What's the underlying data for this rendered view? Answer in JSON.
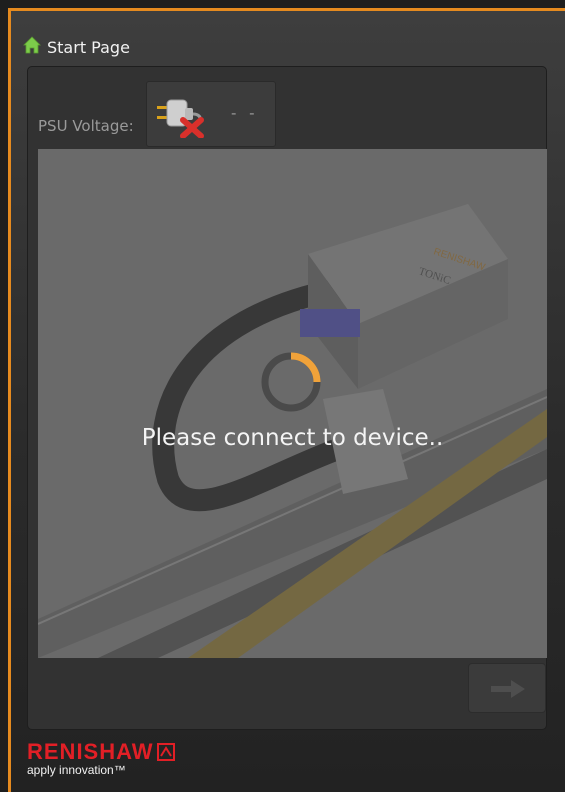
{
  "header": {
    "title": "Start Page",
    "home_icon": "home-icon"
  },
  "psu": {
    "label": "PSU Voltage:",
    "value": "- -",
    "status_icon": "unplugged-power-icon"
  },
  "main": {
    "message": "Please connect to device..",
    "spinner_icon": "loading-spinner-icon"
  },
  "navigation": {
    "next_icon": "arrow-right-icon"
  },
  "footer": {
    "brand": "RENISHAW",
    "tagline": "apply innovation™"
  },
  "colors": {
    "accent": "#e58a1f",
    "brand": "#e21f26",
    "spinner": "#f0a23a"
  }
}
